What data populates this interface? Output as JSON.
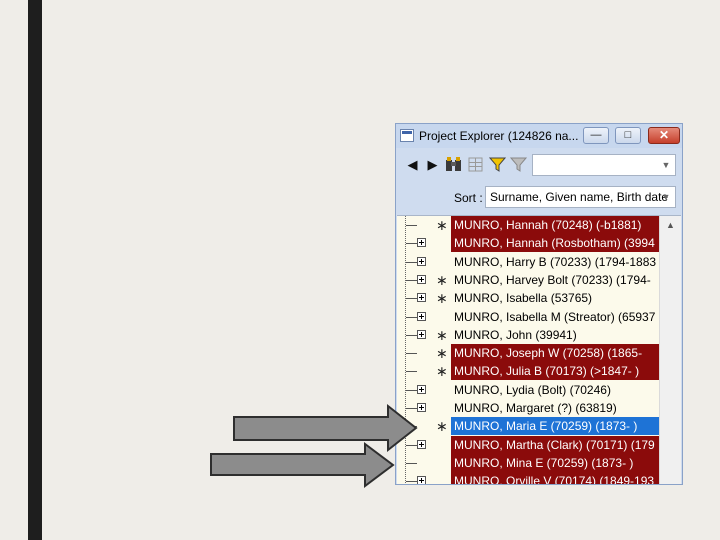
{
  "window": {
    "title": "Project Explorer (124826 na...",
    "buttons": {
      "minimize": "—",
      "maximize": "□",
      "close": "✕"
    }
  },
  "toolbar": {
    "icons": [
      "arrow-left-icon",
      "arrow-right-icon",
      "binoculars-icon",
      "grid-icon",
      "filter-icon",
      "clear-filter-icon"
    ],
    "search_value": ""
  },
  "sort": {
    "label": "Sort :",
    "value": "Surname, Given name, Birth date"
  },
  "tree": {
    "items": [
      {
        "label": "MUNRO, Hannah (70248) (-b1881)",
        "marker": "∗",
        "expander": false,
        "style": "hl"
      },
      {
        "label": "MUNRO, Hannah (Rosbotham) (3994",
        "marker": "",
        "expander": true,
        "style": "hl"
      },
      {
        "label": "MUNRO, Harry B (70233) (1794-1883",
        "marker": "",
        "expander": true,
        "style": "none"
      },
      {
        "label": "MUNRO, Harvey Bolt (70233) (1794-",
        "marker": "∗",
        "expander": true,
        "style": "none"
      },
      {
        "label": "MUNRO, Isabella (53765)",
        "marker": "∗",
        "expander": true,
        "style": "none"
      },
      {
        "label": "MUNRO, Isabella M (Streator) (65937",
        "marker": "",
        "expander": true,
        "style": "none"
      },
      {
        "label": "MUNRO, John (39941)",
        "marker": "∗",
        "expander": true,
        "style": "none"
      },
      {
        "label": "MUNRO, Joseph W (70258) (1865-",
        "marker": "∗",
        "expander": false,
        "style": "hl"
      },
      {
        "label": "MUNRO, Julia B (70173) (>1847-   )",
        "marker": "∗",
        "expander": false,
        "style": "hl"
      },
      {
        "label": "MUNRO, Lydia (Bolt) (70246)",
        "marker": "",
        "expander": true,
        "style": "none"
      },
      {
        "label": "MUNRO, Margaret (?) (63819)",
        "marker": "",
        "expander": true,
        "style": "none"
      },
      {
        "label": "MUNRO, Maria E (70259) (1873-   )",
        "marker": "∗",
        "expander": false,
        "style": "sel"
      },
      {
        "label": "MUNRO, Martha (Clark) (70171) (179",
        "marker": "",
        "expander": true,
        "style": "hl"
      },
      {
        "label": "MUNRO, Mina E (70259) (1873-   )",
        "marker": "",
        "expander": false,
        "style": "hl"
      },
      {
        "label": "MUNRO, Orville V (70174) (1849-193",
        "marker": "",
        "expander": true,
        "style": "hl"
      }
    ]
  },
  "colors": {
    "highlight_row": "#8b0b0b",
    "selected_row": "#1e73d6",
    "arrow_fill": "#8c8c8c",
    "arrow_stroke": "#2e2e2e"
  }
}
